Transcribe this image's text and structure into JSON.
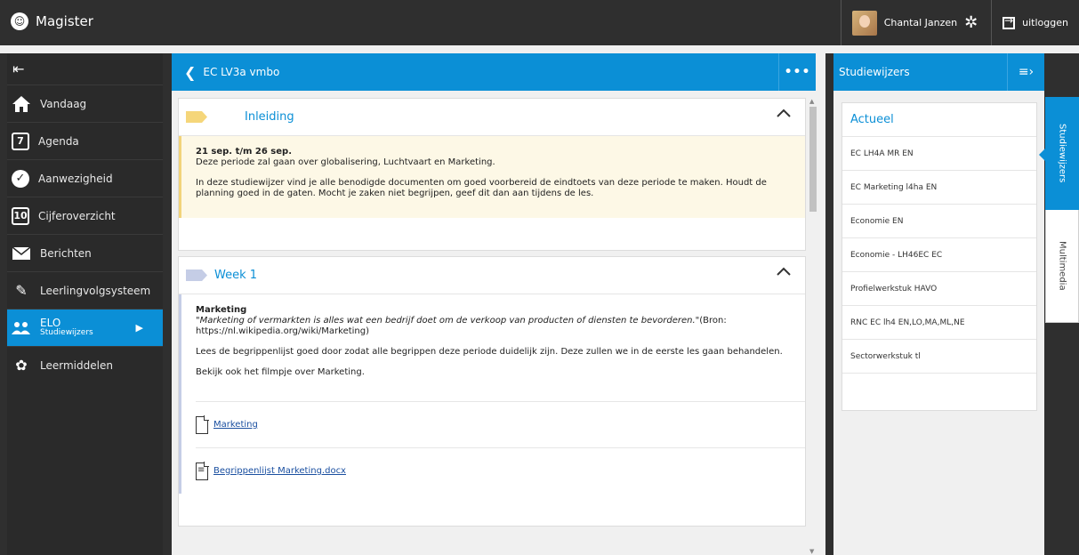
{
  "app": {
    "name": "Magister"
  },
  "user": {
    "name": "Chantal Janzen",
    "logout_label": "uitloggen"
  },
  "sidebar": {
    "items": [
      {
        "label": "Vandaag"
      },
      {
        "label": "Agenda",
        "icon_text": "7"
      },
      {
        "label": "Aanwezigheid"
      },
      {
        "label": "Cijferoverzicht",
        "icon_text": "10"
      },
      {
        "label": "Berichten"
      },
      {
        "label": "Leerlingvolgsysteem"
      },
      {
        "label": "ELO",
        "sublabel": "Studiewijzers"
      },
      {
        "label": "Leermiddelen"
      }
    ]
  },
  "main": {
    "title": "EC LV3a vmbo",
    "sections": [
      {
        "title": "Inleiding",
        "tag_color": "#f5d67a",
        "date_range": "21 sep. t/m 26 sep.",
        "line1": "Deze periode zal gaan over globalisering, Luchtvaart en Marketing.",
        "para": "In deze studiewijzer vind je alle benodigde documenten om goed voorbereid de eindtoets van deze periode te maken. Houdt de planning goed in de gaten.  Mocht je zaken niet begrijpen, geef dit dan aan tijdens de les."
      },
      {
        "title": "Week 1",
        "tag_color": "#c5cde6",
        "heading": "Marketing",
        "quote": "\"Marketing of vermarkten is alles wat een bedrijf doet om de verkoop van producten of diensten te bevorderen.\"",
        "source": "(Bron: https://nl.wikipedia.org/wiki/Marketing)",
        "para1": "Lees de begrippenlijst goed door zodat alle begrippen deze periode duidelijk zijn. Deze zullen we in de eerste les gaan behandelen.",
        "para2": "Bekijk ook het filmpje over Marketing.",
        "attachments": [
          {
            "label": "Marketing",
            "icon": "file-icon"
          },
          {
            "label": "Begrippenlijst Marketing.docx",
            "icon": "document-icon"
          }
        ]
      }
    ]
  },
  "right": {
    "title": "Studiewijzers",
    "card_title": "Actueel",
    "items": [
      "EC LH4A MR EN",
      "EC Marketing l4ha EN",
      "Economie EN",
      "Economie - LH46EC EC",
      "Profielwerkstuk HAVO",
      "RNC EC lh4 EN,LO,MA,ML,NE",
      "Sectorwerkstuk tl"
    ]
  },
  "tabs": {
    "active": "Studiewijzers",
    "inactive": "Multimedia"
  },
  "colors": {
    "accent": "#0b8fd6",
    "topbar": "#2f2f2f",
    "sidebar": "#2a2a2a"
  }
}
